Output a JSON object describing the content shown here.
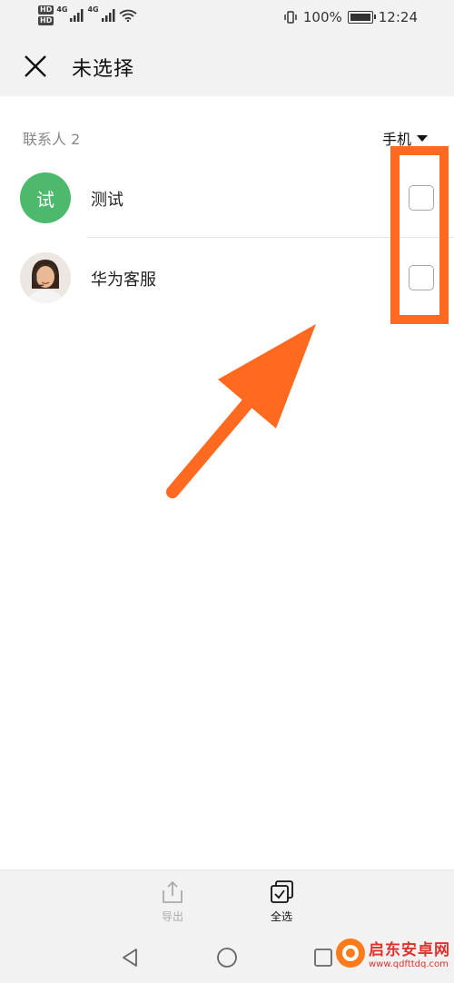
{
  "status_bar": {
    "hd_labels": [
      "HD",
      "HD"
    ],
    "net_labels": [
      "4G",
      "4G"
    ],
    "battery": "100%",
    "time": "12:24"
  },
  "header": {
    "title": "未选择"
  },
  "contacts_section": {
    "count_label": "联系人 2",
    "filter_label": "手机"
  },
  "contacts": [
    {
      "avatar_letter": "试",
      "name": "测试",
      "selected": false
    },
    {
      "avatar_letter": "",
      "name": "华为客服",
      "selected": false
    }
  ],
  "bottom_actions": {
    "export_label": "导出",
    "select_all_label": "全选"
  },
  "watermark": {
    "title": "启东安卓网",
    "url": "www.qdfttdq.com"
  },
  "colors": {
    "accent_green": "#4cb96d",
    "annotation_orange": "#ff6a20",
    "bar_background": "#f2f2f2"
  }
}
